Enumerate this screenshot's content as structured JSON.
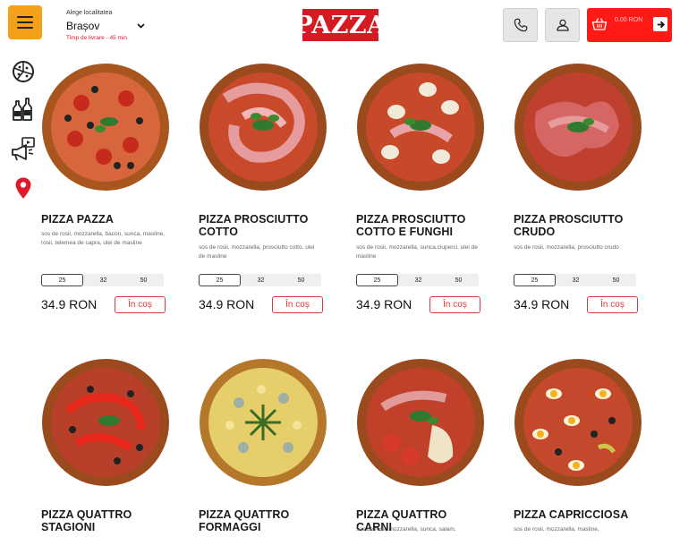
{
  "header": {
    "location_label": "Alege localitatea",
    "city": "Brașov",
    "delivery_time": "Timp de livrare - 45 min",
    "logo": "PAZZA",
    "cart_total": "0.00 RON"
  },
  "sidebar": {
    "items": [
      {
        "icon": "pizza-icon"
      },
      {
        "icon": "drinks-icon"
      },
      {
        "icon": "promo-megaphone-icon"
      },
      {
        "icon": "location-pin-icon"
      }
    ]
  },
  "products": [
    {
      "name": "PIZZA PAZZA",
      "desc": "sos de rosii, mozzarella, bacon, sunca, masline, rosii, telemea de capra, ulei de masline",
      "sizes": [
        "25",
        "32",
        "50"
      ],
      "price": "34.9 RON",
      "add_label": "În coș"
    },
    {
      "name": "PIZZA PROSCIUTTO COTTO",
      "desc": "sos de rosii, mozzarella, prosciutto cotto, ulei de masline",
      "sizes": [
        "25",
        "32",
        "50"
      ],
      "price": "34.9 RON",
      "add_label": "În coș"
    },
    {
      "name": "PIZZA PROSCIUTTO COTTO E FUNGHI",
      "desc": "sos de rosii, mozzarella, sunca,ciuperci, ulei de masline",
      "sizes": [
        "25",
        "32",
        "50"
      ],
      "price": "34.9 RON",
      "add_label": "În coș"
    },
    {
      "name": "PIZZA PROSCIUTTO CRUDO",
      "desc": "sos de rosii, mozzarella, prosciutto crudo",
      "sizes": [
        "25",
        "32",
        "50"
      ],
      "price": "34.9 RON",
      "add_label": "În coș"
    },
    {
      "name": "PIZZA QUATTRO STAGIONI",
      "desc": "",
      "sizes": [],
      "price": "",
      "add_label": ""
    },
    {
      "name": "PIZZA QUATTRO FORMAGGI",
      "desc": "",
      "sizes": [],
      "price": "",
      "add_label": ""
    },
    {
      "name": "PIZZA QUATTRO CARNI",
      "desc": "sos de rosii, mozzarella, sunca, salam,",
      "sizes": [],
      "price": "",
      "add_label": ""
    },
    {
      "name": "PIZZA CAPRICCIOSA",
      "desc": "sos de rosii, mozzarella, masline,",
      "sizes": [],
      "price": "",
      "add_label": ""
    }
  ],
  "colors": {
    "accent": "#f5a01a",
    "brand_red": "#d41a22",
    "cart_red": "#ff1a16",
    "button_red": "#e23a3a"
  }
}
